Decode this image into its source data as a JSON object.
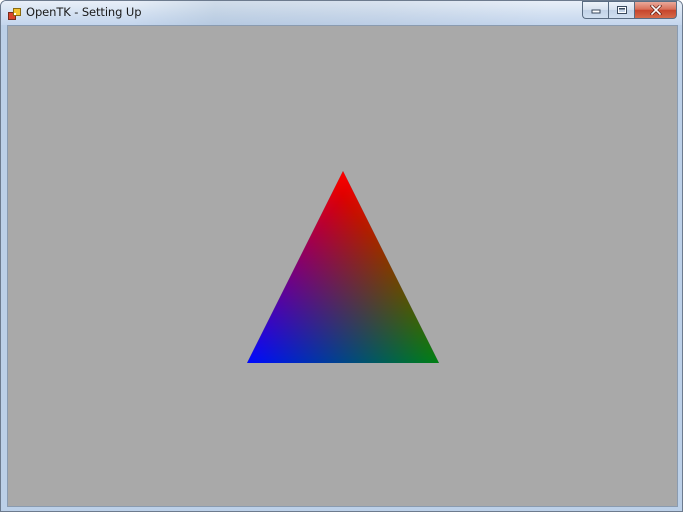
{
  "window": {
    "title": "OpenTK - Setting Up",
    "icons": {
      "app": "app-icon",
      "minimize": "minimize-icon",
      "maximize": "maximize-icon",
      "close": "close-icon"
    },
    "colors": {
      "client_background": "#a9a9a9",
      "close_button": "#c7452c"
    }
  },
  "scene": {
    "shape": "triangle",
    "vertex_colors": {
      "top": "#ff0000",
      "bottom_left": "#0000ff",
      "bottom_right": "#008000"
    }
  }
}
